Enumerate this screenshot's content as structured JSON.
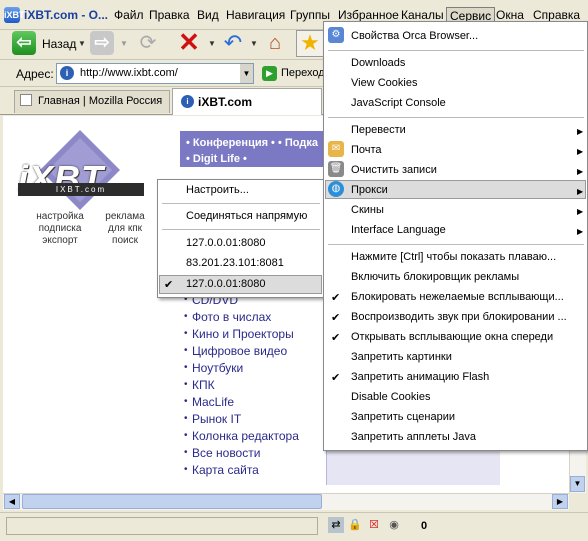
{
  "window": {
    "title": "iXBT.com - O...",
    "app_icon": "iXBT"
  },
  "menubar": {
    "items": [
      "Файл",
      "Правка",
      "Вид",
      "Навигация",
      "Группы",
      "Избранное",
      "Каналы",
      "Сервис",
      "Окна",
      "Справка"
    ]
  },
  "toolbar": {
    "back_label": "Назад",
    "icons": [
      "back-arrow-icon",
      "forward-arrow-icon",
      "reload-icon",
      "stop-icon",
      "undo-icon",
      "home-icon",
      "favorites-star-icon"
    ],
    "back_glyph": "⇦",
    "forward_glyph": "⇨",
    "reload_glyph": "⟳",
    "stop_glyph": "✕",
    "undo_glyph": "↶",
    "home_glyph": "⌂",
    "star_glyph": "★",
    "dropdown_glyph": "▼"
  },
  "addressbar": {
    "label": "Адрес:",
    "value": "http://www.ixbt.com/",
    "go_label": "Переход",
    "site_glyph": "i",
    "go_glyph": "▶"
  },
  "tabs": [
    {
      "label": "Главная | Mozilla Россия",
      "active": false
    },
    {
      "label": "iXBT.com",
      "active": true,
      "glyph": "i"
    }
  ],
  "page": {
    "logo_text": "iXBT",
    "logo_bar_text": "IXBT.com",
    "left_links_col1": [
      "настройка",
      "подписка",
      "экспорт"
    ],
    "left_links_col2": [
      "реклама",
      "для кпк",
      "поиск"
    ],
    "nav_top_lines": [
      "• Конференция • • Подка",
      "• Digit Life •"
    ],
    "nav_links": [
      "CD/DVD",
      "Фото в числах",
      "Кино и Проекторы",
      "Цифровое видео",
      "Ноутбуки",
      "КПК",
      "MacLife",
      "Рынок IT",
      "Колонка редактора",
      "Все новости",
      "Карта сайта"
    ],
    "nav_dot": "•"
  },
  "proxy_submenu": {
    "items": [
      "Настроить...",
      "Соединяться напрямую",
      "127.0.0.01:8080",
      "83.201.23.101:8081",
      "127.0.0.01:8080"
    ],
    "checked_index": 4,
    "check_glyph": "✔"
  },
  "service_menu": {
    "items": [
      {
        "label": "Свойства Orca Browser...",
        "icon": "orca-properties-icon"
      },
      {
        "label": "Downloads"
      },
      {
        "label": "View Cookies"
      },
      {
        "label": "JavaScript Console"
      },
      {
        "label": "Перевести",
        "submenu": true
      },
      {
        "label": "Почта",
        "submenu": true,
        "icon": "mail-icon"
      },
      {
        "label": "Очистить записи",
        "submenu": true,
        "icon": "trash-icon"
      },
      {
        "label": "Прокси",
        "submenu": true,
        "icon": "globe-icon",
        "highlighted": true
      },
      {
        "label": "Скины",
        "submenu": true
      },
      {
        "label": "Interface Language",
        "submenu": true
      },
      {
        "label": "Нажмите [Ctrl] чтобы показать плаваю..."
      },
      {
        "label": "Включить блокировщик рекламы"
      },
      {
        "label": "Блокировать нежелаемые всплывающи...",
        "checked": true
      },
      {
        "label": "Воспроизводить звук при блокировании ...",
        "checked": true
      },
      {
        "label": "Открывать всплывающие окна спереди",
        "checked": true
      },
      {
        "label": "Запретить картинки"
      },
      {
        "label": "Запретить анимацию Flash",
        "checked": true
      },
      {
        "label": "Disable Cookies"
      },
      {
        "label": "Запретить сценарии"
      },
      {
        "label": "Запретить апплеты Java"
      }
    ],
    "submenu_arrow_glyph": "▶",
    "check_glyph": "✔"
  },
  "statusbar": {
    "text": "",
    "popup_count": "0",
    "icons": [
      "network-icon",
      "lock-icon",
      "popup-blocked-icon",
      "sound-icon"
    ]
  },
  "colors": {
    "nav_purple": "#7b78c4",
    "nav_light": "#e6e5f4",
    "link": "#2a2a8a",
    "stop_red": "#d01010",
    "back_green": "#2ea02e",
    "star_yellow": "#f0b400"
  }
}
